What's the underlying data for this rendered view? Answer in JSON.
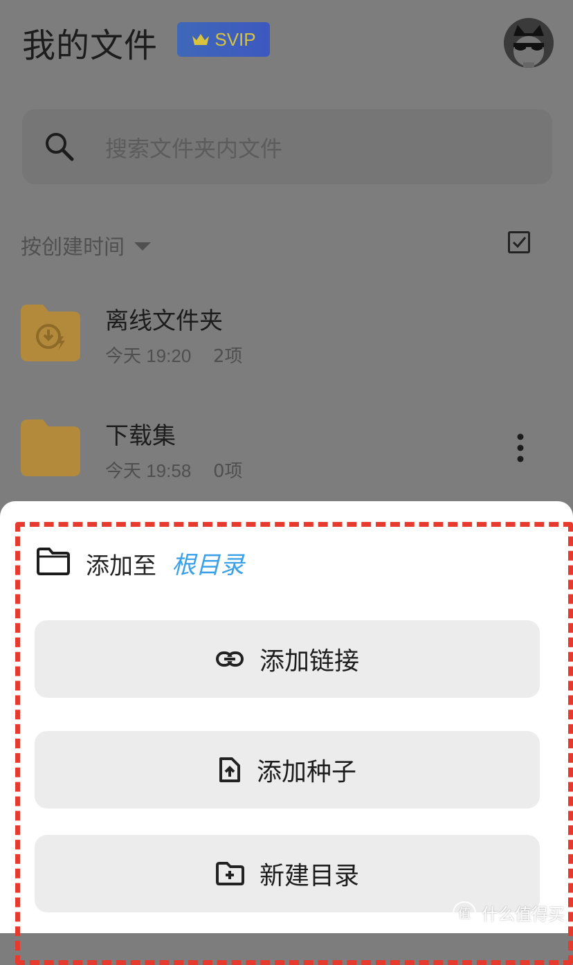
{
  "header": {
    "title": "我的文件",
    "badge": "SVIP"
  },
  "search": {
    "placeholder": "搜索文件夹内文件"
  },
  "sort": {
    "label": "按创建时间"
  },
  "files": [
    {
      "name": "离线文件夹",
      "time": "今天 19:20",
      "count": "2项"
    },
    {
      "name": "下载集",
      "time": "今天 19:58",
      "count": "0项"
    }
  ],
  "sheet": {
    "add_to_label": "添加至",
    "destination": "根目录",
    "actions": [
      {
        "label": "添加链接",
        "icon": "link-icon"
      },
      {
        "label": "添加种子",
        "icon": "file-upload-icon"
      },
      {
        "label": "新建目录",
        "icon": "folder-plus-icon"
      }
    ]
  },
  "watermark": {
    "symbol": "值",
    "text": "什么值得买"
  },
  "colors": {
    "overlay": "#7d7d7d",
    "accent": "#3aa1e8",
    "highlight_border": "#e63a2e",
    "folder": "#b38a3c",
    "button_bg": "#ececec"
  }
}
